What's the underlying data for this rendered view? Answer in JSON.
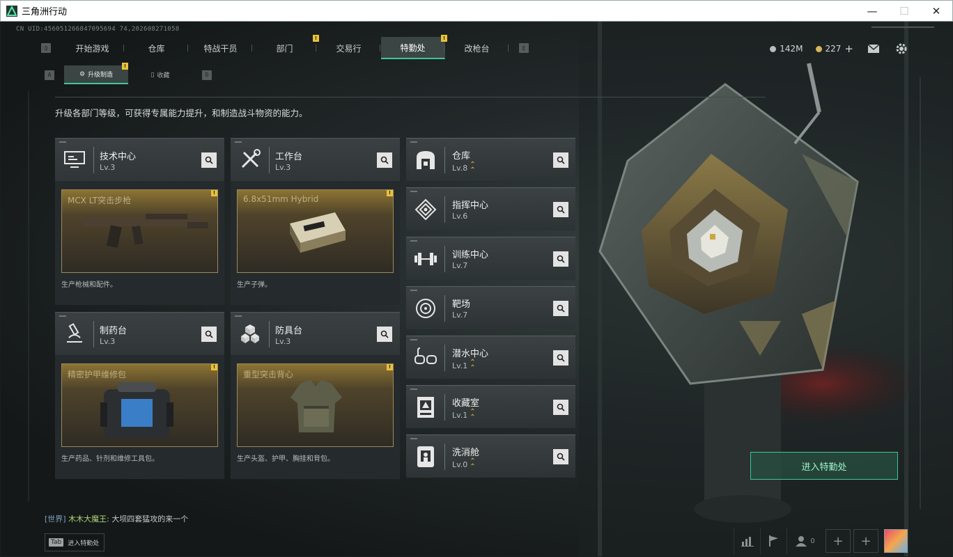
{
  "window": {
    "title": "三角洲行动",
    "minimize": "—",
    "maximize": "☐",
    "close": "✕"
  },
  "uid": "CN UID:456051266847095694 74,202608271058",
  "nav": {
    "left_key": "Q",
    "right_key": "E",
    "tabs": [
      {
        "label": "开始游戏",
        "badge": ""
      },
      {
        "label": "仓库",
        "badge": ""
      },
      {
        "label": "特战干员",
        "badge": ""
      },
      {
        "label": "部门",
        "badge": "!"
      },
      {
        "label": "交易行",
        "badge": ""
      },
      {
        "label": "特勤处",
        "badge": "!"
      },
      {
        "label": "改枪台",
        "badge": ""
      }
    ],
    "active_index": 5
  },
  "resources": {
    "silver": "142M",
    "gold": "227",
    "gold_add": "+"
  },
  "subnav": {
    "left_key": "A",
    "right_key": "D",
    "tabs": [
      {
        "label": "升级制造",
        "badge": "!"
      },
      {
        "label": "收藏",
        "badge": ""
      }
    ]
  },
  "description": "升级各部门等级，可获得专属能力提升，和制造战斗物资的能力。",
  "big_cards": [
    {
      "name": "技术中心",
      "level": "Lv.3",
      "item": "MCX LT突击步枪",
      "badge": "!",
      "footer": "生产枪械和配件。",
      "icon": "monitor-icon"
    },
    {
      "name": "工作台",
      "level": "Lv.3",
      "item": "6.8x51mm Hybrid",
      "badge": "!",
      "footer": "生产子弹。",
      "icon": "tools-icon"
    },
    {
      "name": "制药台",
      "level": "Lv.3",
      "item": "精密护甲维修包",
      "badge": "!",
      "footer": "生产药品、针剂和维修工具包。",
      "icon": "microscope-icon"
    },
    {
      "name": "防具台",
      "level": "Lv.3",
      "item": "重型突击背心",
      "badge": "!",
      "footer": "生产头盔、护甲、胸挂和背包。",
      "icon": "cubes-icon"
    }
  ],
  "row_cards": [
    {
      "name": "仓库",
      "level": "Lv.8",
      "upgrade": true,
      "icon": "warehouse-icon"
    },
    {
      "name": "指挥中心",
      "level": "Lv.6",
      "upgrade": false,
      "icon": "command-icon"
    },
    {
      "name": "训练中心",
      "level": "Lv.7",
      "upgrade": false,
      "icon": "dumbbell-icon"
    },
    {
      "name": "靶场",
      "level": "Lv.7",
      "upgrade": false,
      "icon": "target-icon"
    },
    {
      "name": "潜水中心",
      "level": "Lv.1",
      "upgrade": true,
      "icon": "diving-mask-icon"
    },
    {
      "name": "收藏室",
      "level": "Lv.1",
      "upgrade": true,
      "icon": "trophy-case-icon"
    },
    {
      "name": "洗消舱",
      "level": "Lv.0",
      "upgrade": true,
      "icon": "decon-icon"
    }
  ],
  "enter_button": "进入特勤处",
  "chat": {
    "channel": "[世界]",
    "name": "木木大魔王:",
    "message": "大坝四套猛攻的来一个"
  },
  "tab_hint": {
    "key": "Tab",
    "label": "进入特勤处"
  },
  "bottom": {
    "friends_count": "0"
  },
  "colors": {
    "accent": "#3ec79a",
    "badge": "#e9c13b",
    "card": "#3b4142"
  }
}
